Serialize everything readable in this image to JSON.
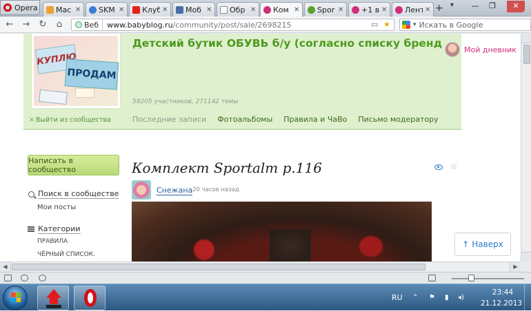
{
  "browser": {
    "opera_label": "Opera",
    "tabs": [
      {
        "label": "Мас",
        "icon": "babyblog-icon",
        "color": "#f0a030"
      },
      {
        "label": "SKM",
        "icon": "skm-icon",
        "color": "#3a7bd5"
      },
      {
        "label": "Клуб",
        "icon": "youtube-icon",
        "color": "#e62117"
      },
      {
        "label": "Моб",
        "icon": "doc-icon",
        "color": "#4a6fa5"
      },
      {
        "label": "Обр",
        "icon": "page-icon",
        "color": "#ffffff"
      },
      {
        "label": "Ком",
        "icon": "babyblog-icon",
        "color": "#d02e7a"
      },
      {
        "label": "Spor",
        "icon": "sport-icon",
        "color": "#5aa02c"
      },
      {
        "label": "+1 в",
        "icon": "babyblog-icon",
        "color": "#d02e7a"
      },
      {
        "label": "Лент",
        "icon": "babyblog-icon",
        "color": "#d02e7a"
      }
    ],
    "url_web_label": "Веб",
    "url_host": "www.babyblog.ru",
    "url_path": "/community/post/sale/2698215",
    "search_placeholder": "Искать в Google"
  },
  "community": {
    "title": "Детский бутик ОБУВЬ б/у (согласно списку бренд",
    "stats": "59205 участников, 271142 темы",
    "leave_label": "Выйти из сообщества",
    "logo_text_1": "КУПЛЮ",
    "logo_text_2": "ПРОДАМ",
    "nav": [
      "Последние записи",
      "Фотоальбомы",
      "Правила и ЧаВо",
      "Письмо модератору"
    ],
    "my_diary": "Мой дневник"
  },
  "sidebar": {
    "publish_button": "Написать в сообщество",
    "search_label": "Поиск в сообществе",
    "my_posts": "Мои посты",
    "categories_label": "Категории",
    "categories": [
      "ПРАВИЛА",
      "ЧЁРНЫЙ СПИСОК."
    ]
  },
  "post": {
    "title": "Комплект Sportalm р.116",
    "author": "Снежана",
    "time": "20 часов назад"
  },
  "up_button": "Наверх",
  "taskbar": {
    "lang": "RU",
    "time": "23:44",
    "date": "21.12.2013"
  },
  "colors": {
    "accent_green": "#4d9a1f",
    "header_bg": "#dff0ce",
    "link_blue": "#2a7cc7",
    "pink": "#d02e7a"
  }
}
